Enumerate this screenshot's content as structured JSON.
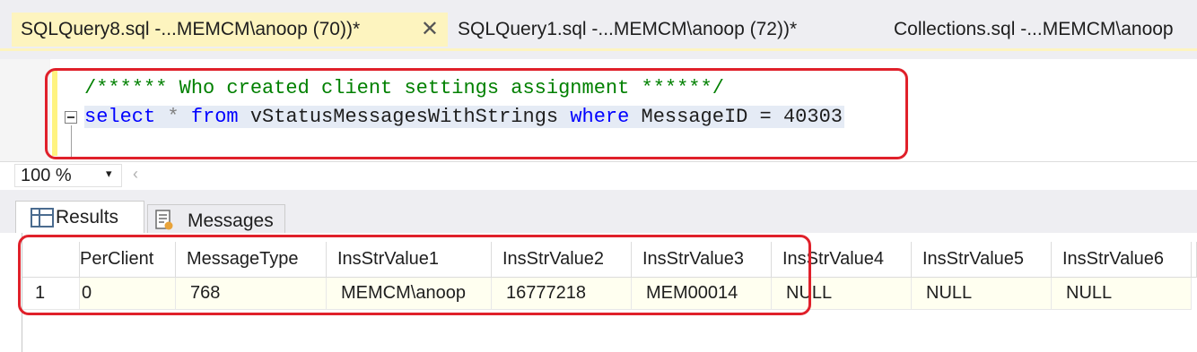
{
  "tabs": [
    {
      "label": "SQLQuery8.sql -...MEMCM\\anoop (70))*",
      "active": true,
      "close_glyph": "✕"
    },
    {
      "label": "SQLQuery1.sql -...MEMCM\\anoop (72))*",
      "active": false
    },
    {
      "label": "Collections.sql -...MEMCM\\anoop",
      "active": false
    }
  ],
  "editor": {
    "comment": "/****** Who created client settings assignment ******/",
    "code": {
      "kw_select": "select",
      "star": " * ",
      "kw_from": "from",
      "view": " vStatusMessagesWithStrings ",
      "kw_where": "where",
      "cond": " MessageID = 40303"
    }
  },
  "zoom": {
    "value": "100 %",
    "arrow": "▾",
    "scroll": "‹"
  },
  "result_tabs": {
    "results": "Results",
    "messages": "Messages"
  },
  "grid": {
    "columns": [
      "PerClient",
      "MessageType",
      "InsStrValue1",
      "InsStrValue2",
      "InsStrValue3",
      "InsStrValue4",
      "InsStrValue5",
      "InsStrValue6"
    ],
    "rows": [
      {
        "num": "1",
        "cells": [
          "0",
          "768",
          "MEMCM\\anoop",
          "16777218",
          "MEM00014",
          "NULL",
          "NULL",
          "NULL"
        ]
      }
    ]
  },
  "colors": {
    "highlight": "#e0202a",
    "active_tab": "#fdf4bf",
    "keyword": "#0000ff",
    "comment": "#008000"
  },
  "icons": [
    "close-icon",
    "chevron-down-icon",
    "grid-icon",
    "messages-icon",
    "collapse-icon"
  ]
}
